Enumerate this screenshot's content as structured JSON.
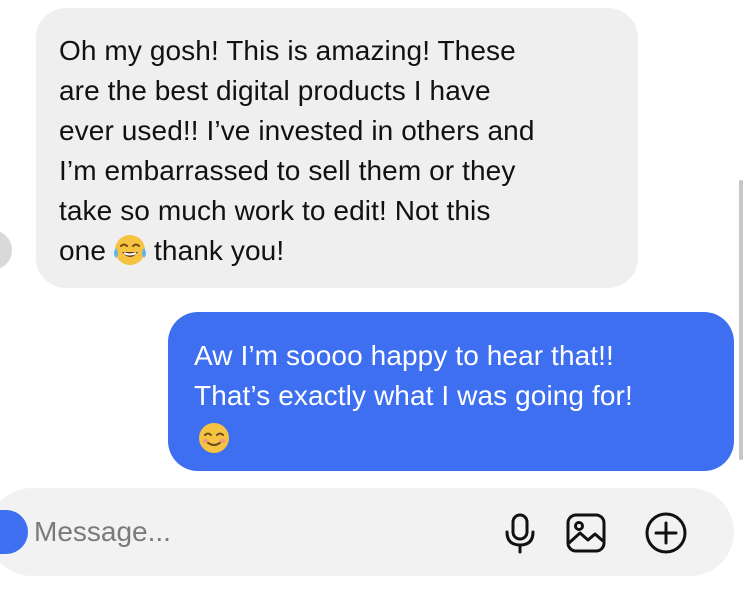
{
  "conversation": {
    "incoming": {
      "lines": [
        "Oh my gosh! This is amazing! These",
        "are the best digital products I have",
        "ever used!! I’ve invested in others and",
        "I’m embarrassed to sell them or they",
        "take so much work to edit! Not this"
      ],
      "last_line_before_emoji": "one",
      "emoji": "face-with-tears-of-joy",
      "last_line_after_emoji": "thank you!"
    },
    "outgoing": {
      "lines": [
        "Aw I’m soooo happy to hear that!!",
        "That’s exactly what I was going for!"
      ],
      "emoji": "smiling-face"
    }
  },
  "composer": {
    "placeholder": "Message...",
    "icons": [
      "camera-icon",
      "microphone-icon",
      "photo-icon",
      "plus-circle-icon"
    ]
  },
  "colors": {
    "incoming_bubble": "#efefef",
    "outgoing_bubble": "#3e6ff0",
    "composer_background": "#f2f2f2"
  }
}
